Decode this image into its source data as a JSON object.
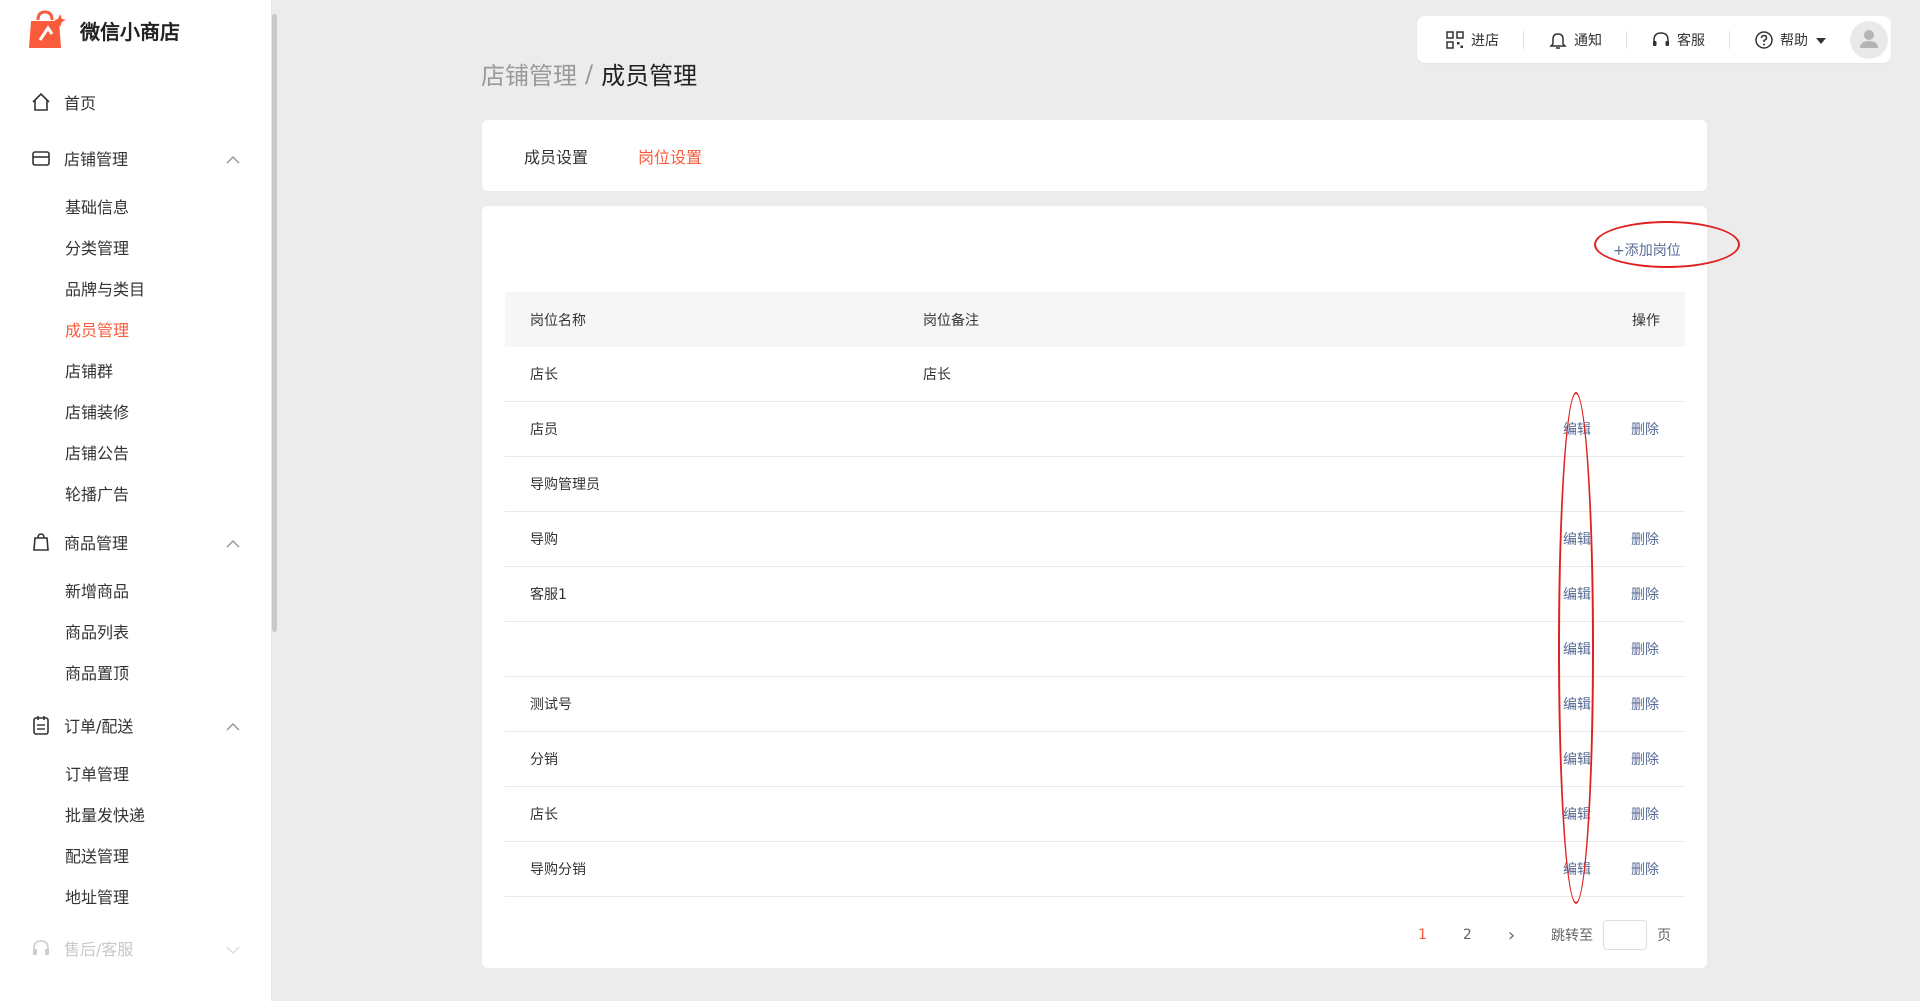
{
  "app": {
    "name": "微信小商店"
  },
  "sidebar": {
    "home": "首页",
    "shop": {
      "label": "店铺管理",
      "items": [
        "基础信息",
        "分类管理",
        "品牌与类目",
        "成员管理",
        "店铺群",
        "店铺装修",
        "店铺公告",
        "轮播广告"
      ]
    },
    "goods": {
      "label": "商品管理",
      "items": [
        "新增商品",
        "商品列表",
        "商品置顶"
      ]
    },
    "orders": {
      "label": "订单/配送",
      "items": [
        "订单管理",
        "批量发快递",
        "配送管理",
        "地址管理"
      ]
    },
    "after": {
      "label": "售后/客服"
    }
  },
  "topbar": {
    "enter": "进店",
    "notify": "通知",
    "service": "客服",
    "help": "帮助"
  },
  "breadcrumb": {
    "parent": "店铺管理",
    "separator": "/",
    "current": "成员管理"
  },
  "tabs": [
    "成员设置",
    "岗位设置"
  ],
  "add_button": "+添加岗位",
  "table": {
    "headers": {
      "name": "岗位名称",
      "note": "岗位备注",
      "op": "操作"
    },
    "edit_label": "编辑",
    "delete_label": "删除",
    "rows": [
      {
        "name": "店长",
        "note": "店长",
        "actions": false
      },
      {
        "name": "店员",
        "note": "",
        "actions": true
      },
      {
        "name": "导购管理员",
        "note": "",
        "actions": false
      },
      {
        "name": "导购",
        "note": "",
        "actions": true
      },
      {
        "name": "客服1",
        "note": "",
        "actions": true
      },
      {
        "name": "",
        "note": "",
        "actions": true
      },
      {
        "name": "测试号",
        "note": "",
        "actions": true
      },
      {
        "name": "分销",
        "note": "",
        "actions": true
      },
      {
        "name": "店长",
        "note": "",
        "actions": true
      },
      {
        "name": "导购分销",
        "note": "",
        "actions": true
      }
    ]
  },
  "pagination": {
    "pages": [
      "1",
      "2"
    ],
    "next": "›",
    "jump_label": "跳转至",
    "page_unit": "页"
  },
  "colors": {
    "accent": "#fa5b3b",
    "link": "#576b95",
    "annotation": "#e02020"
  }
}
